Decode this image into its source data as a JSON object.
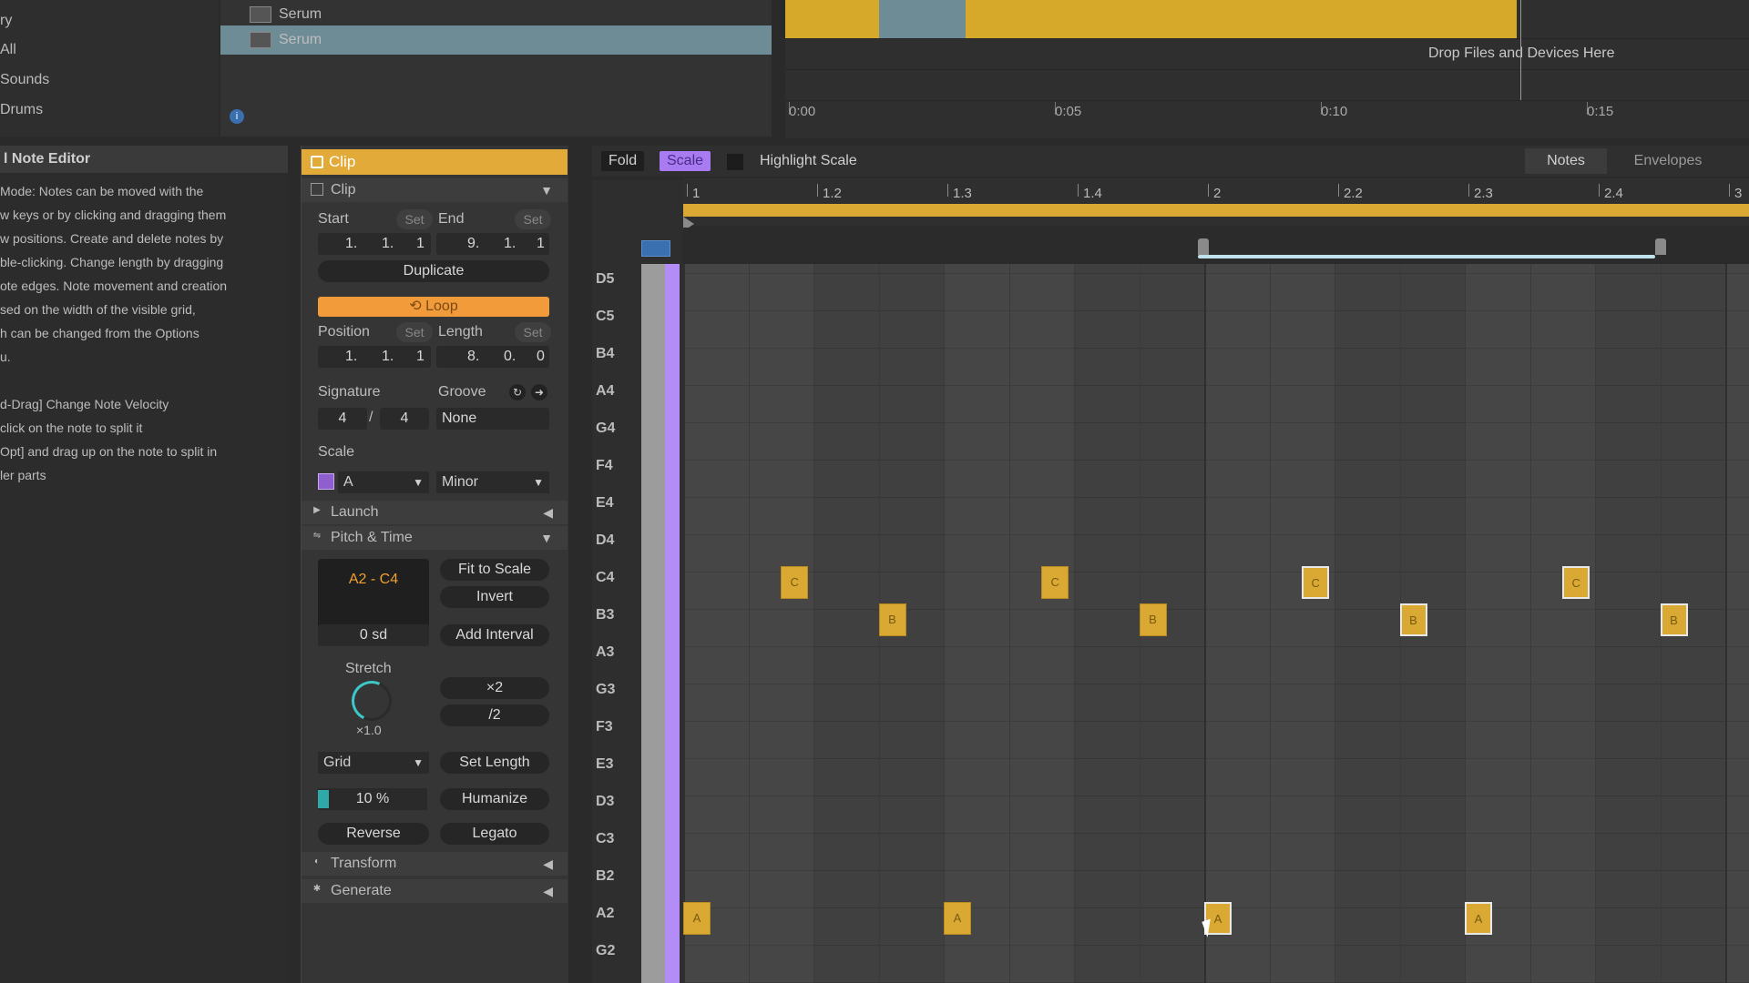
{
  "browser": {
    "categories": [
      "ry",
      "All",
      "Sounds",
      "Drums"
    ],
    "items": [
      "Serum",
      "Serum"
    ]
  },
  "arrangement": {
    "drop_text": "Drop Files and Devices Here",
    "time_labels": [
      "0:00",
      "0:05",
      "0:10",
      "0:15"
    ]
  },
  "help": {
    "title": "l Note Editor",
    "lines": [
      "Mode: Notes can be moved with the",
      "w keys or by clicking and dragging them",
      "w positions. Create and delete notes by",
      "ble-clicking.  Change length by dragging",
      "ote edges. Note movement and creation",
      "sed on the width of the visible grid,",
      "h can be changed from the Options",
      "u.",
      "",
      "d-Drag] Change Note Velocity",
      " click on the note to split it",
      "Opt] and drag up on the note to split in",
      "ler parts"
    ]
  },
  "clip": {
    "header": "Clip",
    "section_clip": "Clip",
    "start_label": "Start",
    "end_label": "End",
    "set": "Set",
    "start_value": [
      "1.",
      "1.",
      "1"
    ],
    "end_value": [
      "9.",
      "1.",
      "1"
    ],
    "duplicate": "Duplicate",
    "loop": "Loop",
    "position_label": "Position",
    "length_label": "Length",
    "position_value": [
      "1.",
      "1.",
      "1"
    ],
    "length_value": [
      "8.",
      "0.",
      "0"
    ],
    "signature_label": "Signature",
    "groove_label": "Groove",
    "sig_num": "4",
    "sig_sep": "/",
    "sig_den": "4",
    "groove_value": "None",
    "scale_label": "Scale",
    "scale_root": "A",
    "scale_mode": "Minor",
    "launch": "Launch",
    "pitch_time": "Pitch & Time",
    "range": "A2 - C4",
    "fit_to_scale": "Fit to Scale",
    "invert": "Invert",
    "interval_value": "0 sd",
    "add_interval": "Add Interval",
    "stretch_label": "Stretch",
    "stretch_value": "×1.0",
    "times2": "×2",
    "div2": "/2",
    "grid": "Grid",
    "set_length": "Set Length",
    "humanize_value": "10 %",
    "humanize_level": 0.1,
    "humanize": "Humanize",
    "reverse": "Reverse",
    "legato": "Legato",
    "transform": "Transform",
    "generate": "Generate"
  },
  "roll": {
    "fold": "Fold",
    "scale": "Scale",
    "highlight_scale": "Highlight Scale",
    "tab_notes": "Notes",
    "tab_envelopes": "Envelopes",
    "ruler_labels": [
      "1",
      "1.2",
      "1.3",
      "1.4",
      "2",
      "2.2",
      "2.3",
      "2.4",
      "3"
    ],
    "keys": [
      "D5",
      "C5",
      "B4",
      "A4",
      "G4",
      "F4",
      "E4",
      "D4",
      "C4",
      "B3",
      "A3",
      "G3",
      "F3",
      "E3",
      "D3",
      "C3",
      "B2",
      "A2",
      "G2"
    ],
    "notes": [
      {
        "label": "A",
        "pitch": "A2",
        "beat": 0,
        "selected": false
      },
      {
        "label": "C",
        "pitch": "C4",
        "beat": 0.75,
        "selected": false
      },
      {
        "label": "B",
        "pitch": "B3",
        "beat": 1.5,
        "selected": false
      },
      {
        "label": "A",
        "pitch": "A2",
        "beat": 2,
        "selected": false
      },
      {
        "label": "C",
        "pitch": "C4",
        "beat": 2.75,
        "selected": false
      },
      {
        "label": "B",
        "pitch": "B3",
        "beat": 3.5,
        "selected": false
      },
      {
        "label": "A",
        "pitch": "A2",
        "beat": 4,
        "selected": true
      },
      {
        "label": "C",
        "pitch": "C4",
        "beat": 4.75,
        "selected": true
      },
      {
        "label": "B",
        "pitch": "B3",
        "beat": 5.5,
        "selected": true
      },
      {
        "label": "A",
        "pitch": "A2",
        "beat": 6,
        "selected": true
      },
      {
        "label": "C",
        "pitch": "C4",
        "beat": 6.75,
        "selected": true
      },
      {
        "label": "B",
        "pitch": "B3",
        "beat": 7.5,
        "selected": true
      }
    ]
  }
}
